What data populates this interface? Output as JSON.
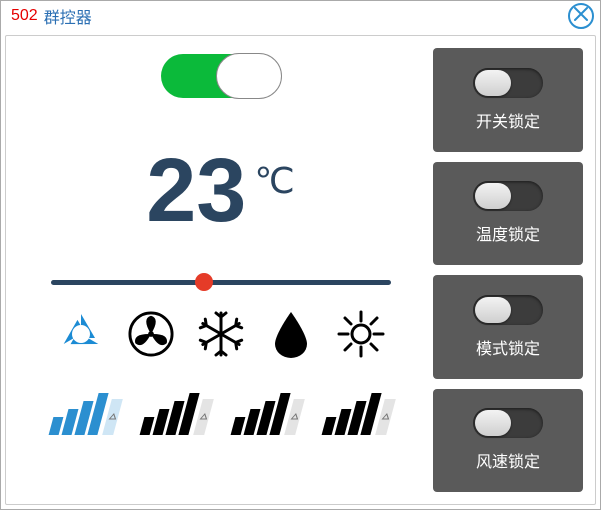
{
  "header": {
    "device_id": "502",
    "device_name": "群控器"
  },
  "power": {
    "on": true
  },
  "temperature": {
    "value": "23",
    "unit": "℃",
    "min": 16,
    "max": 30
  },
  "slider": {
    "percent": 45
  },
  "modes": [
    {
      "key": "auto",
      "icon": "recycle-icon",
      "active": true
    },
    {
      "key": "fan",
      "icon": "fan-icon",
      "active": false
    },
    {
      "key": "cool",
      "icon": "snowflake-icon",
      "active": false
    },
    {
      "key": "dry",
      "icon": "droplet-icon",
      "active": false
    },
    {
      "key": "heat",
      "icon": "sun-icon",
      "active": false
    }
  ],
  "fan_speeds": [
    {
      "level": 1,
      "active": true
    },
    {
      "level": 2,
      "active": false
    },
    {
      "level": 3,
      "active": false
    },
    {
      "level": 4,
      "active": false
    }
  ],
  "locks": [
    {
      "key": "power_lock",
      "label": "开关锁定",
      "on": false
    },
    {
      "key": "temp_lock",
      "label": "温度锁定",
      "on": false
    },
    {
      "key": "mode_lock",
      "label": "模式锁定",
      "on": false
    },
    {
      "key": "fan_lock",
      "label": "风速锁定",
      "on": false
    }
  ],
  "colors": {
    "accent": "#2b8fd0",
    "dark": "#2b4560",
    "green": "#0bba3a",
    "red": "#e53b28"
  }
}
